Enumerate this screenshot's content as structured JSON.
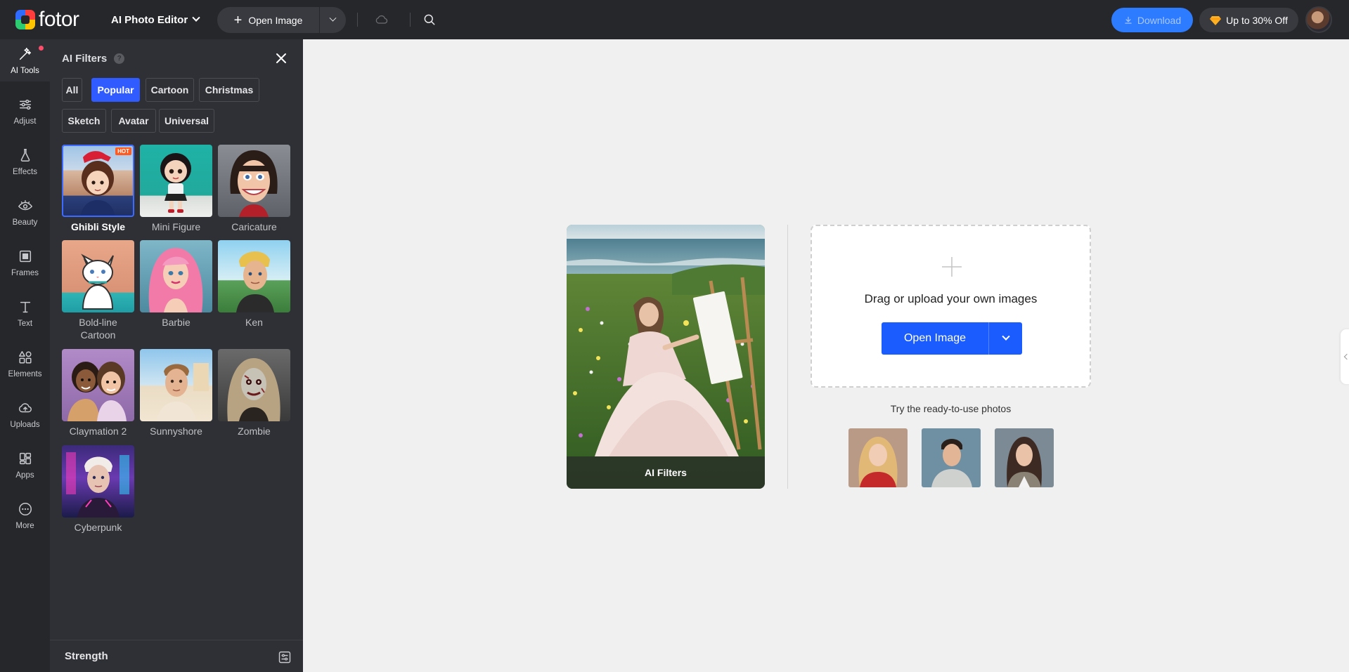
{
  "header": {
    "logo_text": "fotor",
    "editor_label": "AI Photo Editor",
    "open_image_label": "Open Image",
    "download_label": "Download",
    "promo_label": "Up to 30% Off"
  },
  "rail": {
    "items": [
      {
        "label": "AI Tools",
        "icon": "magic-wand-icon"
      },
      {
        "label": "Adjust",
        "icon": "sliders-icon"
      },
      {
        "label": "Effects",
        "icon": "flask-icon"
      },
      {
        "label": "Beauty",
        "icon": "eye-icon"
      },
      {
        "label": "Frames",
        "icon": "frame-icon"
      },
      {
        "label": "Text",
        "icon": "text-icon"
      },
      {
        "label": "Elements",
        "icon": "shapes-icon"
      },
      {
        "label": "Uploads",
        "icon": "cloud-upload-icon"
      },
      {
        "label": "Apps",
        "icon": "apps-icon"
      },
      {
        "label": "More",
        "icon": "more-icon"
      }
    ]
  },
  "panel": {
    "title": "AI Filters",
    "help": "?",
    "chips": [
      "All",
      "Popular",
      "Cartoon",
      "Christmas",
      "Sketch",
      "Avatar",
      "Universal"
    ],
    "active_chip": "Popular",
    "hot_badge": "HOT",
    "filters": [
      {
        "label": "Ghibli Style",
        "selected": true
      },
      {
        "label": "Mini Figure"
      },
      {
        "label": "Caricature"
      },
      {
        "label": "Bold-line Cartoon"
      },
      {
        "label": "Barbie"
      },
      {
        "label": "Ken"
      },
      {
        "label": "Claymation 2"
      },
      {
        "label": "Sunnyshore"
      },
      {
        "label": "Zombie"
      },
      {
        "label": "Cyberpunk"
      }
    ],
    "strength_label": "Strength"
  },
  "main": {
    "hero_caption": "AI Filters",
    "drop_text": "Drag or upload your own images",
    "open_image_label": "Open Image",
    "try_text": "Try the ready-to-use photos"
  },
  "colors": {
    "topbar_bg": "#26272b",
    "panel_bg": "#2f3035",
    "accent_blue": "#2f5bff",
    "download_blue": "#2d7bff",
    "hot_orange": "#ff5a1f",
    "canvas_bg": "#f0f0f0"
  }
}
